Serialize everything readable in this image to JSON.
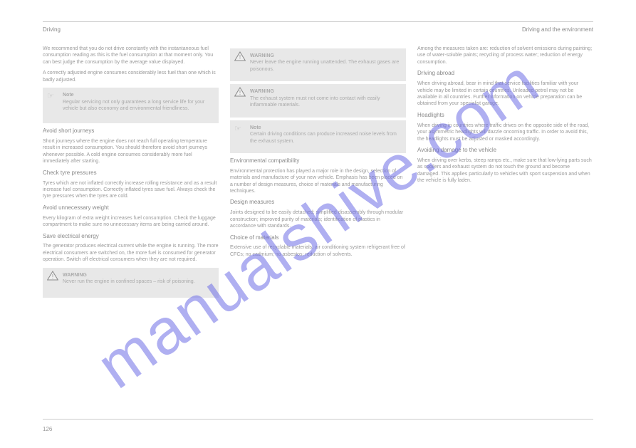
{
  "header": {
    "left": "Driving",
    "right": "Driving and the environment"
  },
  "column1": {
    "p1": "We recommend that you do not drive constantly with the instantaneous fuel consumption reading as this is the fuel consumption at that moment only. You can best judge the consumption by the average value displayed.",
    "p2": "A correctly adjusted engine consumes considerably less fuel than one which is badly adjusted.",
    "noteLabel": "Note",
    "noteText": "Regular servicing not only guarantees a long service life for your vehicle but also economy and environmental friendliness.",
    "sec1Title": "Avoid short journeys",
    "sec1Body": "Short journeys where the engine does not reach full operating temperature result in increased consumption. You should therefore avoid short journeys whenever possible. A cold engine consumes considerably more fuel immediately after starting.",
    "sec2Title": "Check tyre pressures",
    "sec2Body": "Tyres which are not inflated correctly increase rolling resistance and as a result increase fuel consumption. Correctly inflated tyres save fuel. Always check the tyre pressures when the tyres are cold.",
    "sec3Title": "Avoid unnecessary weight",
    "sec3Body": "Every kilogram of extra weight increases fuel consumption. Check the luggage compartment to make sure no unnecessary items are being carried around.",
    "sec4Title": "Save electrical energy",
    "sec4Body": "The generator produces electrical current while the engine is running. The more electrical consumers are switched on, the more fuel is consumed for generator operation. Switch off electrical consumers when they are not required.",
    "warnLabel": "WARNING",
    "warnText": "Never run the engine in confined spaces – risk of poisoning."
  },
  "column2": {
    "warn1Label": "WARNING",
    "warn1Text": "Never leave the engine running unattended. The exhaust gases are poisonous.",
    "warn2Label": "WARNING",
    "warn2Text": "The exhaust system must not come into contact with easily inflammable materials.",
    "noteLabel": "Note",
    "noteText": "Certain driving conditions can produce increased noise levels from the exhaust system.",
    "sec1Title": "Environmental compatibility",
    "sec1Body": "Environmental protection has played a major role in the design, selection of materials and manufacture of your new vehicle. Emphasis has been placed on a number of design measures, choice of materials and manufacturing techniques.",
    "sec2Title": "Design measures",
    "sec2List": "Joints designed to be easily detached; simplified disassembly through modular construction; improved purity of materials; identification of plastics in accordance with standards.",
    "sec3Title": "Choice of materials",
    "sec3List": "Extensive use of recyclable materials; air conditioning system refrigerant free of CFCs; no cadmium; no asbestos; reduction of solvents."
  },
  "column3": {
    "p1": "Among the measures taken are: reduction of solvent emissions during painting; use of water-soluble paints; recycling of process water; reduction of energy consumption.",
    "sec1Title": "Driving abroad",
    "sec1Body": "When driving abroad, bear in mind that service facilities familiar with your vehicle may be limited in certain countries. Unleaded petrol may not be available in all countries. Further information on vehicle preparation can be obtained from your specialist garage.",
    "sec2Title": "Headlights",
    "sec2Body": "When driving in countries where traffic drives on the opposite side of the road, your asymmetric headlights will dazzle oncoming traffic. In order to avoid this, the headlights must be adjusted or masked accordingly.",
    "sec3Title": "Avoiding damage to the vehicle",
    "sec3Body": "When driving over kerbs, steep ramps etc., make sure that low-lying parts such as spoilers and exhaust system do not touch the ground and become damaged. This applies particularly to vehicles with sport suspension and when the vehicle is fully laden."
  },
  "footer": {
    "page": "126"
  },
  "watermark": "manualshive.com"
}
